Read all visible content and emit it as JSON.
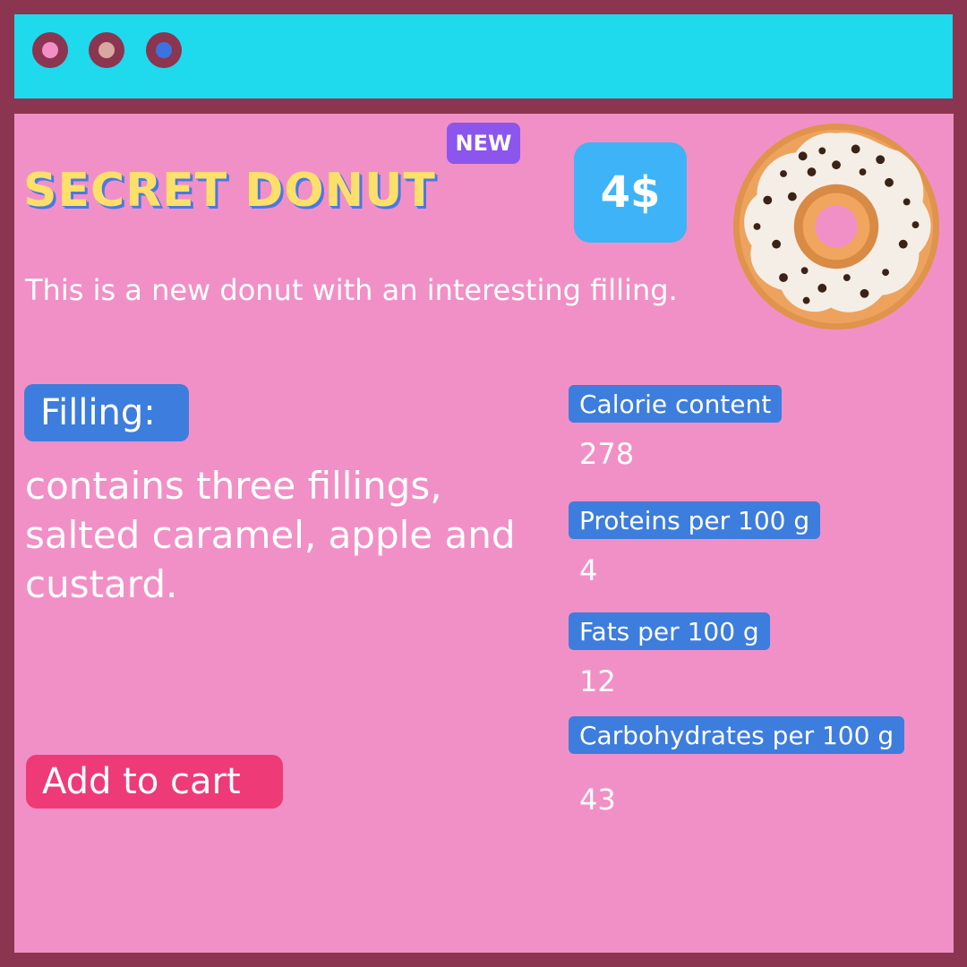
{
  "window": {
    "controls": [
      "close",
      "minimize",
      "maximize"
    ],
    "colors": {
      "titlebar": "#1fd9ed",
      "border": "#8b3550",
      "background": "#f190c6"
    }
  },
  "product": {
    "badge": "NEW",
    "title": "Secret Donut",
    "price": "4$",
    "description": "This is a new donut with an interesting filling.",
    "image_icon": "donut-illustration"
  },
  "filling": {
    "label": "Filling:",
    "text": "contains three fillings, salted caramel, apple and custard."
  },
  "actions": {
    "add_to_cart": "Add to  cart"
  },
  "nutrition": [
    {
      "label": "Calorie content",
      "value": "278"
    },
    {
      "label": "Proteins per 100 g",
      "value": "4"
    },
    {
      "label": "Fats per 100 g",
      "value": "12"
    },
    {
      "label": "Carbohydrates per 100 g",
      "value": "43"
    }
  ]
}
